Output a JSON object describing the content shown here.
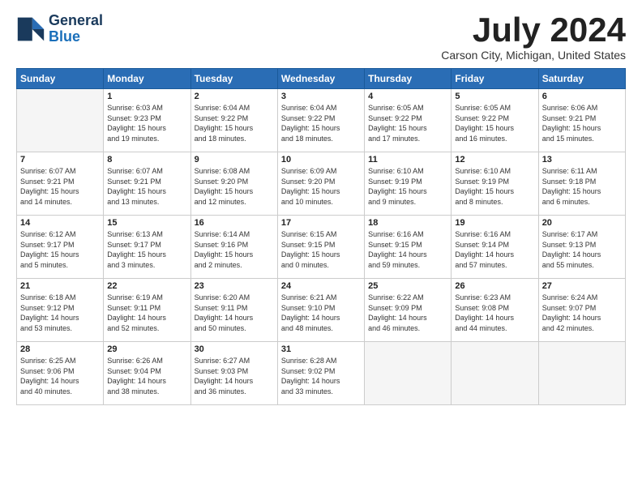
{
  "header": {
    "logo_line1": "General",
    "logo_line2": "Blue",
    "month_title": "July 2024",
    "location": "Carson City, Michigan, United States"
  },
  "weekdays": [
    "Sunday",
    "Monday",
    "Tuesday",
    "Wednesday",
    "Thursday",
    "Friday",
    "Saturday"
  ],
  "weeks": [
    [
      {
        "day": "",
        "info": ""
      },
      {
        "day": "1",
        "info": "Sunrise: 6:03 AM\nSunset: 9:23 PM\nDaylight: 15 hours\nand 19 minutes."
      },
      {
        "day": "2",
        "info": "Sunrise: 6:04 AM\nSunset: 9:22 PM\nDaylight: 15 hours\nand 18 minutes."
      },
      {
        "day": "3",
        "info": "Sunrise: 6:04 AM\nSunset: 9:22 PM\nDaylight: 15 hours\nand 18 minutes."
      },
      {
        "day": "4",
        "info": "Sunrise: 6:05 AM\nSunset: 9:22 PM\nDaylight: 15 hours\nand 17 minutes."
      },
      {
        "day": "5",
        "info": "Sunrise: 6:05 AM\nSunset: 9:22 PM\nDaylight: 15 hours\nand 16 minutes."
      },
      {
        "day": "6",
        "info": "Sunrise: 6:06 AM\nSunset: 9:21 PM\nDaylight: 15 hours\nand 15 minutes."
      }
    ],
    [
      {
        "day": "7",
        "info": "Sunrise: 6:07 AM\nSunset: 9:21 PM\nDaylight: 15 hours\nand 14 minutes."
      },
      {
        "day": "8",
        "info": "Sunrise: 6:07 AM\nSunset: 9:21 PM\nDaylight: 15 hours\nand 13 minutes."
      },
      {
        "day": "9",
        "info": "Sunrise: 6:08 AM\nSunset: 9:20 PM\nDaylight: 15 hours\nand 12 minutes."
      },
      {
        "day": "10",
        "info": "Sunrise: 6:09 AM\nSunset: 9:20 PM\nDaylight: 15 hours\nand 10 minutes."
      },
      {
        "day": "11",
        "info": "Sunrise: 6:10 AM\nSunset: 9:19 PM\nDaylight: 15 hours\nand 9 minutes."
      },
      {
        "day": "12",
        "info": "Sunrise: 6:10 AM\nSunset: 9:19 PM\nDaylight: 15 hours\nand 8 minutes."
      },
      {
        "day": "13",
        "info": "Sunrise: 6:11 AM\nSunset: 9:18 PM\nDaylight: 15 hours\nand 6 minutes."
      }
    ],
    [
      {
        "day": "14",
        "info": "Sunrise: 6:12 AM\nSunset: 9:17 PM\nDaylight: 15 hours\nand 5 minutes."
      },
      {
        "day": "15",
        "info": "Sunrise: 6:13 AM\nSunset: 9:17 PM\nDaylight: 15 hours\nand 3 minutes."
      },
      {
        "day": "16",
        "info": "Sunrise: 6:14 AM\nSunset: 9:16 PM\nDaylight: 15 hours\nand 2 minutes."
      },
      {
        "day": "17",
        "info": "Sunrise: 6:15 AM\nSunset: 9:15 PM\nDaylight: 15 hours\nand 0 minutes."
      },
      {
        "day": "18",
        "info": "Sunrise: 6:16 AM\nSunset: 9:15 PM\nDaylight: 14 hours\nand 59 minutes."
      },
      {
        "day": "19",
        "info": "Sunrise: 6:16 AM\nSunset: 9:14 PM\nDaylight: 14 hours\nand 57 minutes."
      },
      {
        "day": "20",
        "info": "Sunrise: 6:17 AM\nSunset: 9:13 PM\nDaylight: 14 hours\nand 55 minutes."
      }
    ],
    [
      {
        "day": "21",
        "info": "Sunrise: 6:18 AM\nSunset: 9:12 PM\nDaylight: 14 hours\nand 53 minutes."
      },
      {
        "day": "22",
        "info": "Sunrise: 6:19 AM\nSunset: 9:11 PM\nDaylight: 14 hours\nand 52 minutes."
      },
      {
        "day": "23",
        "info": "Sunrise: 6:20 AM\nSunset: 9:11 PM\nDaylight: 14 hours\nand 50 minutes."
      },
      {
        "day": "24",
        "info": "Sunrise: 6:21 AM\nSunset: 9:10 PM\nDaylight: 14 hours\nand 48 minutes."
      },
      {
        "day": "25",
        "info": "Sunrise: 6:22 AM\nSunset: 9:09 PM\nDaylight: 14 hours\nand 46 minutes."
      },
      {
        "day": "26",
        "info": "Sunrise: 6:23 AM\nSunset: 9:08 PM\nDaylight: 14 hours\nand 44 minutes."
      },
      {
        "day": "27",
        "info": "Sunrise: 6:24 AM\nSunset: 9:07 PM\nDaylight: 14 hours\nand 42 minutes."
      }
    ],
    [
      {
        "day": "28",
        "info": "Sunrise: 6:25 AM\nSunset: 9:06 PM\nDaylight: 14 hours\nand 40 minutes."
      },
      {
        "day": "29",
        "info": "Sunrise: 6:26 AM\nSunset: 9:04 PM\nDaylight: 14 hours\nand 38 minutes."
      },
      {
        "day": "30",
        "info": "Sunrise: 6:27 AM\nSunset: 9:03 PM\nDaylight: 14 hours\nand 36 minutes."
      },
      {
        "day": "31",
        "info": "Sunrise: 6:28 AM\nSunset: 9:02 PM\nDaylight: 14 hours\nand 33 minutes."
      },
      {
        "day": "",
        "info": ""
      },
      {
        "day": "",
        "info": ""
      },
      {
        "day": "",
        "info": ""
      }
    ]
  ]
}
